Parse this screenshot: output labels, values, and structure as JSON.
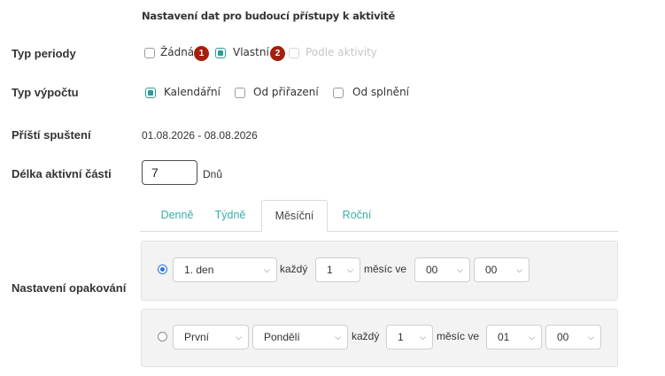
{
  "heading": "Nastavení dat pro budoucí přístupy k aktivitě",
  "period_type": {
    "label": "Typ periody",
    "options": [
      {
        "label": "Žádná",
        "checked": false,
        "disabled": false
      },
      {
        "label": "Vlastní",
        "checked": true,
        "disabled": false
      },
      {
        "label": "Podle aktivity",
        "checked": false,
        "disabled": true
      }
    ],
    "badges": [
      "1",
      "2"
    ]
  },
  "calc_type": {
    "label": "Typ výpočtu",
    "options": [
      {
        "label": "Kalendářní",
        "checked": true
      },
      {
        "label": "Od přiřazení",
        "checked": false
      },
      {
        "label": "Od splnění",
        "checked": false
      }
    ]
  },
  "next_run": {
    "label": "Příští spuštení",
    "value": "01.08.2026 - 08.08.2026"
  },
  "active_length": {
    "label": "Délka aktivní části",
    "value": "7",
    "unit": "Dnů"
  },
  "tabs": [
    {
      "label": "Denně",
      "active": false
    },
    {
      "label": "Týdně",
      "active": false
    },
    {
      "label": "Měsíční",
      "active": true
    },
    {
      "label": "Roční",
      "active": false
    }
  ],
  "repeat": {
    "label": "Nastavení opakování",
    "row1": {
      "selected": true,
      "day": "1. den",
      "every_text": "každý",
      "count": "1",
      "month_text": "měsíc ve",
      "hour": "00",
      "minute": "00"
    },
    "row2": {
      "selected": false,
      "ordinal": "První",
      "weekday": "Pondělí",
      "every_text": "každý",
      "count": "1",
      "month_text": "měsíc ve",
      "hour": "01",
      "minute": "00"
    }
  },
  "colors": {
    "accent": "#2a9d97",
    "badge": "#a51f0d",
    "radio": "#2f72d6",
    "tab_link": "#3aaea8"
  }
}
